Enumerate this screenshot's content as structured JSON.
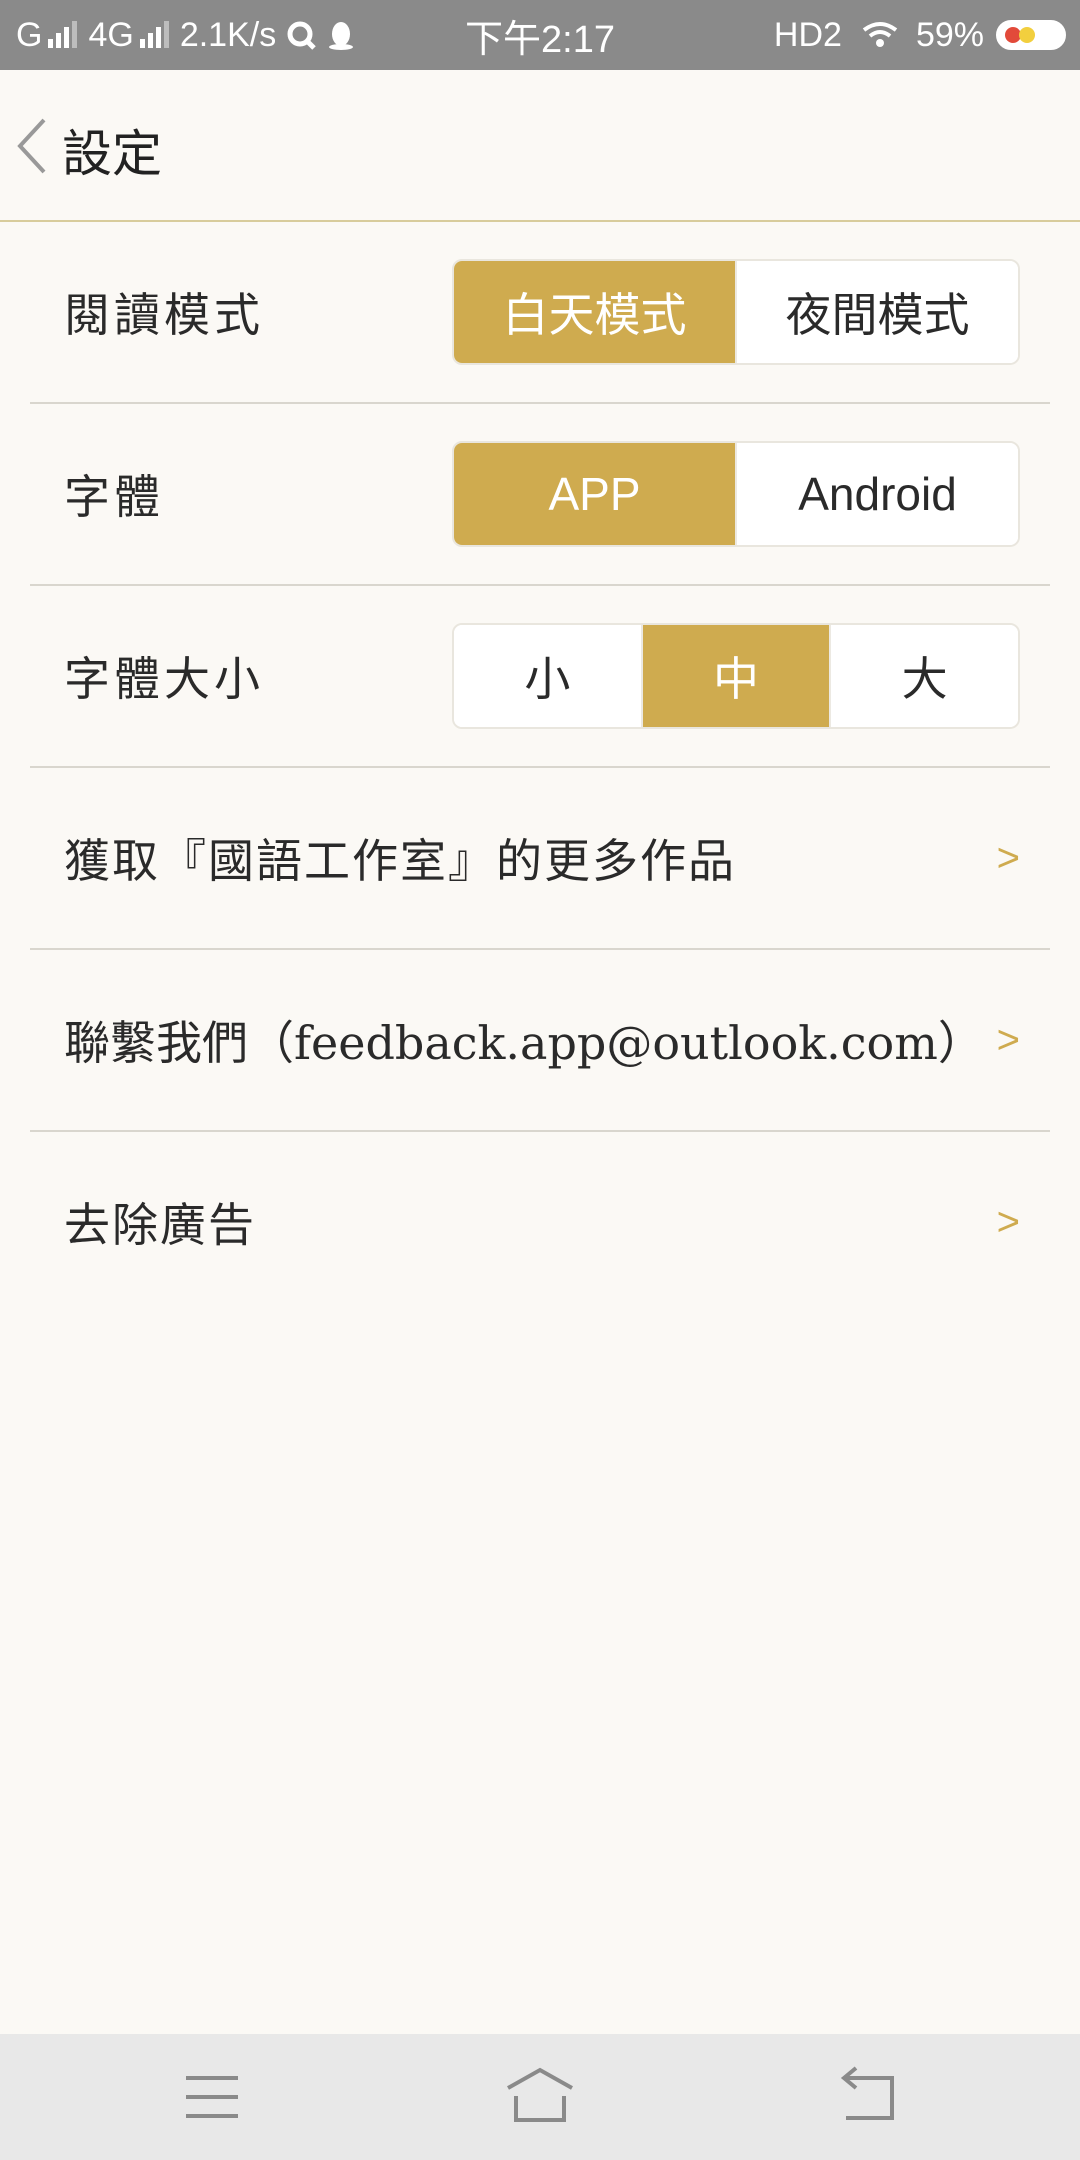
{
  "status_bar": {
    "sim1": "G",
    "sim2": "4G",
    "speed": "2.1K/s",
    "time": "下午2:17",
    "hd": "HD2",
    "battery": "59%"
  },
  "header": {
    "title": "設定"
  },
  "settings": {
    "reading_mode": {
      "label": "閱讀模式",
      "options": [
        "白天模式",
        "夜間模式"
      ],
      "selected": "白天模式"
    },
    "font": {
      "label": "字體",
      "options": [
        "APP",
        "Android"
      ],
      "selected": "APP"
    },
    "font_size": {
      "label": "字體大小",
      "options": [
        "小",
        "中",
        "大"
      ],
      "selected": "中"
    }
  },
  "links": [
    {
      "label": "獲取『國語工作室』的更多作品",
      "chevron": ">"
    },
    {
      "label": "聯繫我們（feedback.app@outlook.com）",
      "chevron": ">"
    },
    {
      "label": "去除廣告",
      "chevron": ">"
    }
  ],
  "colors": {
    "accent": "#cfab4f",
    "background": "#fbf9f5",
    "status_bar": "#8a8a8a"
  },
  "icons": {
    "back": "back-chevron-icon",
    "menu": "menu-icon",
    "home": "home-icon",
    "return": "return-icon"
  }
}
